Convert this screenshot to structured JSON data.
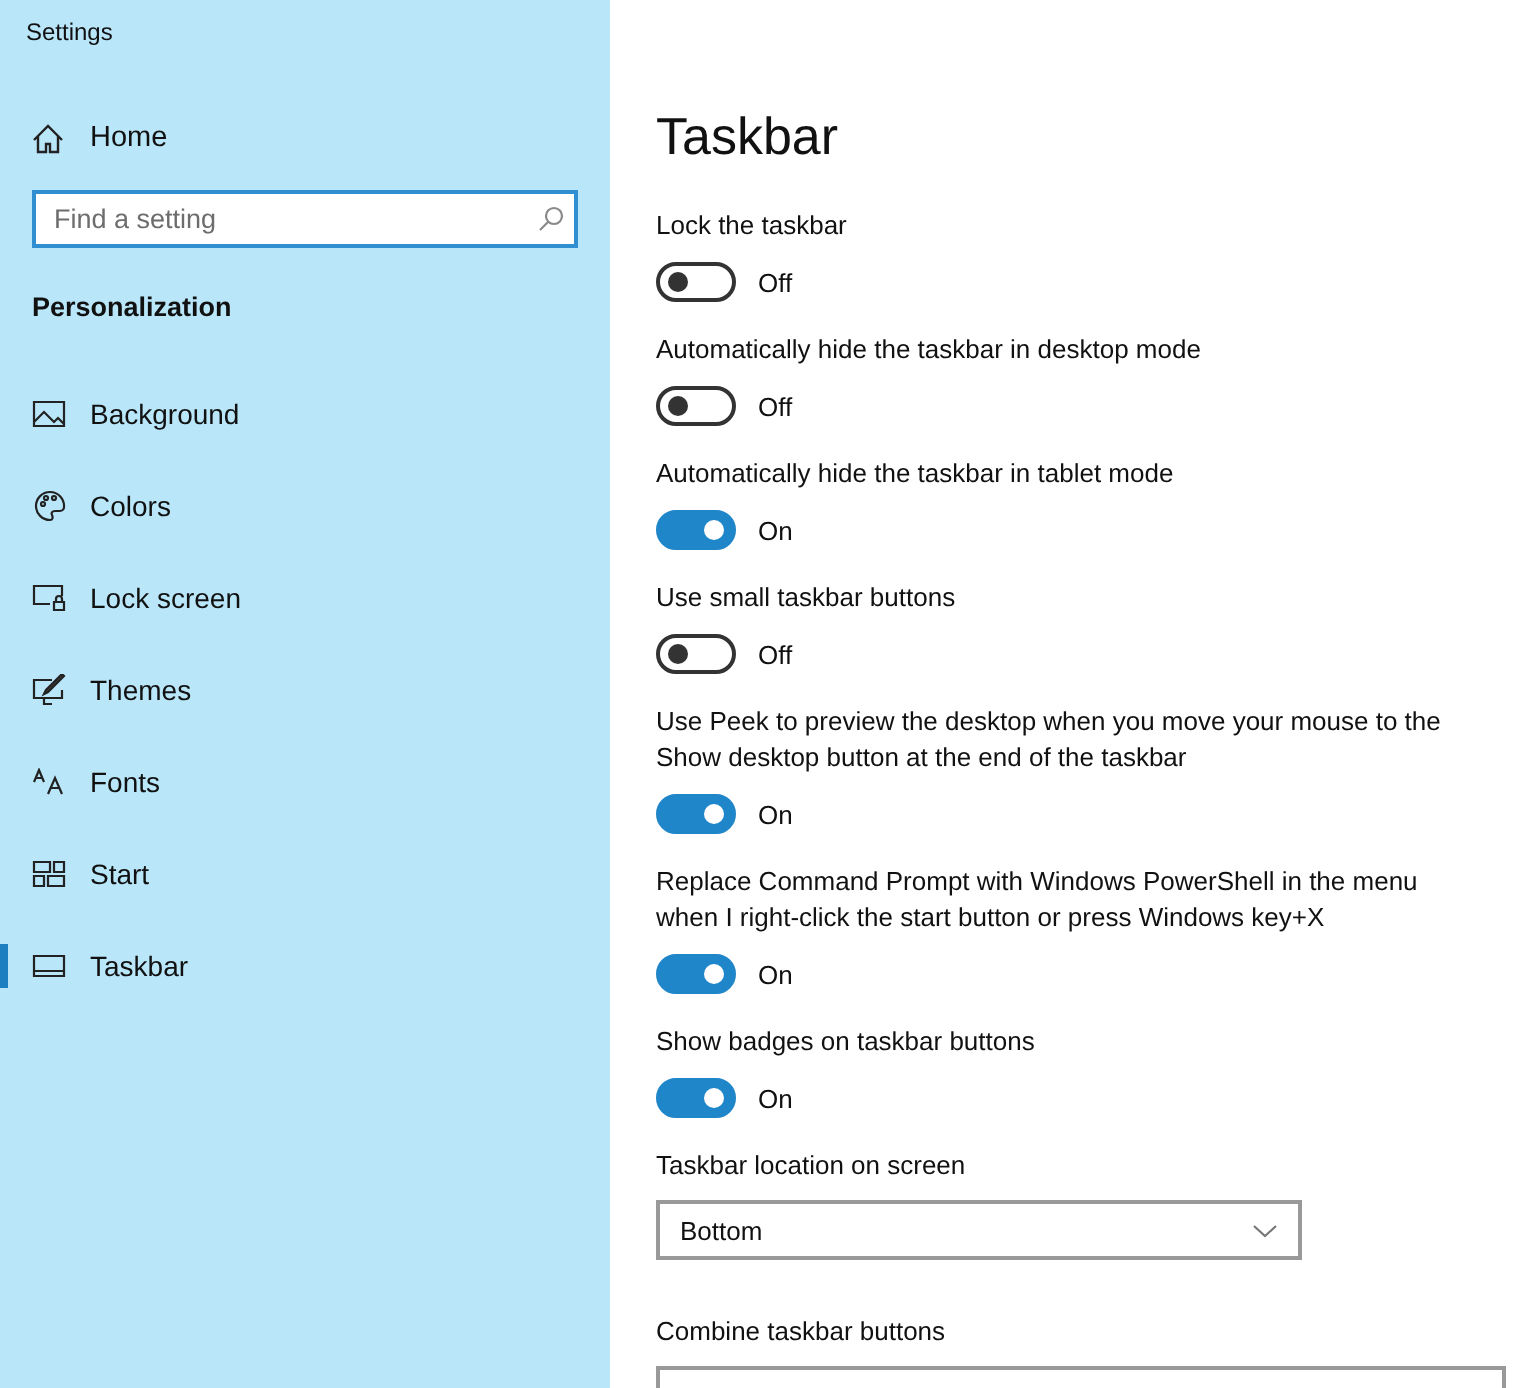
{
  "window": {
    "title": "Settings"
  },
  "sidebar": {
    "home": "Home",
    "search": {
      "placeholder": "Find a setting"
    },
    "section": "Personalization",
    "items": [
      {
        "label": "Background",
        "selected": false
      },
      {
        "label": "Colors",
        "selected": false
      },
      {
        "label": "Lock screen",
        "selected": false
      },
      {
        "label": "Themes",
        "selected": false
      },
      {
        "label": "Fonts",
        "selected": false
      },
      {
        "label": "Start",
        "selected": false
      },
      {
        "label": "Taskbar",
        "selected": true
      }
    ]
  },
  "page": {
    "title": "Taskbar",
    "settings": [
      {
        "kind": "toggle",
        "label": "Lock the taskbar",
        "on": false,
        "state": "Off"
      },
      {
        "kind": "toggle",
        "label": "Automatically hide the taskbar in desktop mode",
        "on": false,
        "state": "Off"
      },
      {
        "kind": "toggle",
        "label": "Automatically hide the taskbar in tablet mode",
        "on": true,
        "state": "On"
      },
      {
        "kind": "toggle",
        "label": "Use small taskbar buttons",
        "on": false,
        "state": "Off"
      },
      {
        "kind": "toggle",
        "label": "Use Peek to preview the desktop when you move your mouse to the Show desktop button at the end of the taskbar",
        "on": true,
        "state": "On"
      },
      {
        "kind": "toggle",
        "label": "Replace Command Prompt with Windows PowerShell in the menu when I right-click the start button or press Windows key+X",
        "on": true,
        "state": "On"
      },
      {
        "kind": "toggle",
        "label": "Show badges on taskbar buttons",
        "on": true,
        "state": "On"
      },
      {
        "kind": "dropdown",
        "label": "Taskbar location on screen",
        "value": "Bottom"
      },
      {
        "kind": "dropdown",
        "label": "Combine taskbar buttons"
      }
    ]
  }
}
